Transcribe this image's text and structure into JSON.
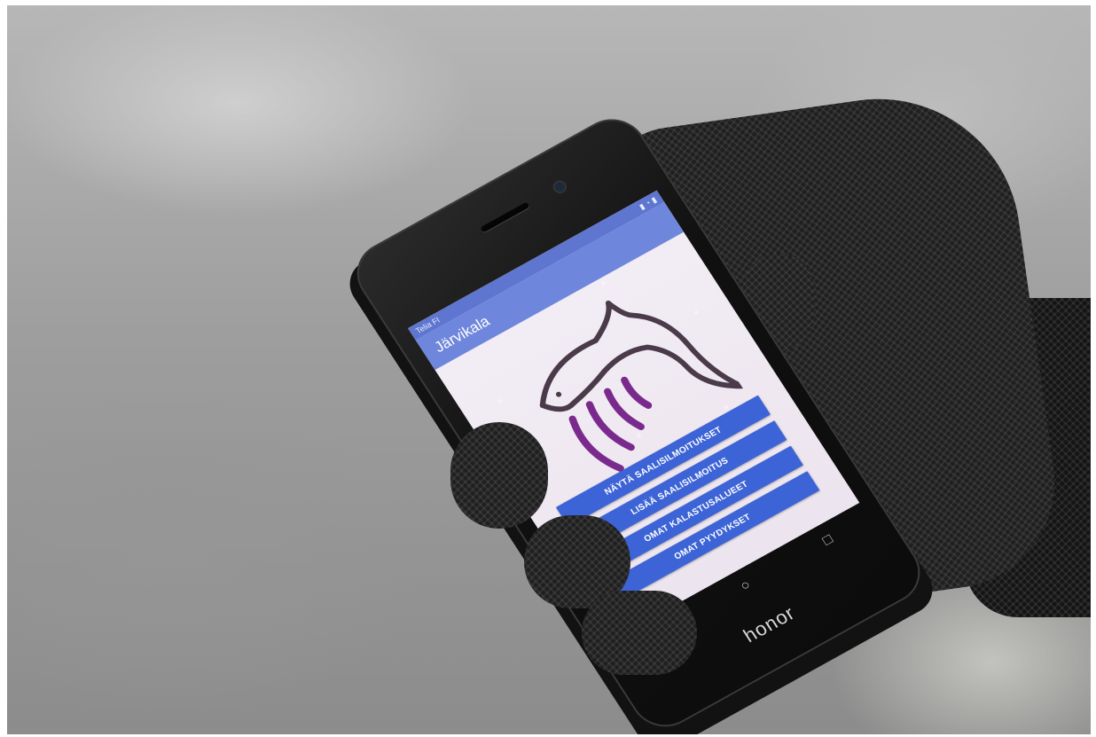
{
  "app": {
    "status_left": "Telia FI",
    "title": "Järvikala"
  },
  "buttons": [
    {
      "label": "NÄYTÄ SAALISILMOITUKSET"
    },
    {
      "label": "LISÄÄ SAALISILMOITUS"
    },
    {
      "label": "OMAT KALASTUSALUEET"
    },
    {
      "label": "OMAT PYYDYKSET"
    }
  ],
  "navbar": {
    "back": "◁",
    "home": "○",
    "recent": "□"
  },
  "device": {
    "brand": "honor"
  },
  "colors": {
    "appbar": "#6f86dd",
    "button": "#3d64d6",
    "logo_purple": "#7a2a8c",
    "logo_dark": "#4a3a4a"
  }
}
